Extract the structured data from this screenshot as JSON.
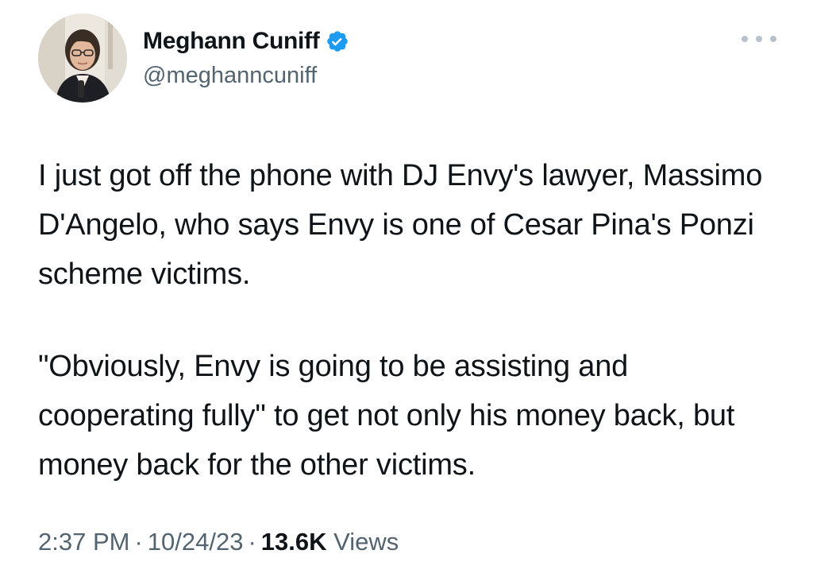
{
  "author": {
    "display_name": "Meghann Cuniff",
    "handle": "@meghanncuniff",
    "verified": true,
    "verified_color": "#1d9bf0",
    "avatar_icon": "profile-photo"
  },
  "more_icon": "more-horizontal-icon",
  "tweet": {
    "paragraphs": [
      "I just got off the phone with DJ Envy's lawyer, Massimo D'Angelo, who says Envy is one of Cesar Pina's Ponzi scheme victims.",
      "\"Obviously, Envy is going to be assisting and cooperating fully\" to get not only his money back, but money back for the other victims."
    ]
  },
  "meta": {
    "time": "2:37 PM",
    "separator": "·",
    "date": "10/24/23",
    "views_count": "13.6K",
    "views_label": "Views"
  },
  "colors": {
    "text_primary": "#0f1419",
    "text_secondary": "#536471",
    "background": "#ffffff"
  }
}
